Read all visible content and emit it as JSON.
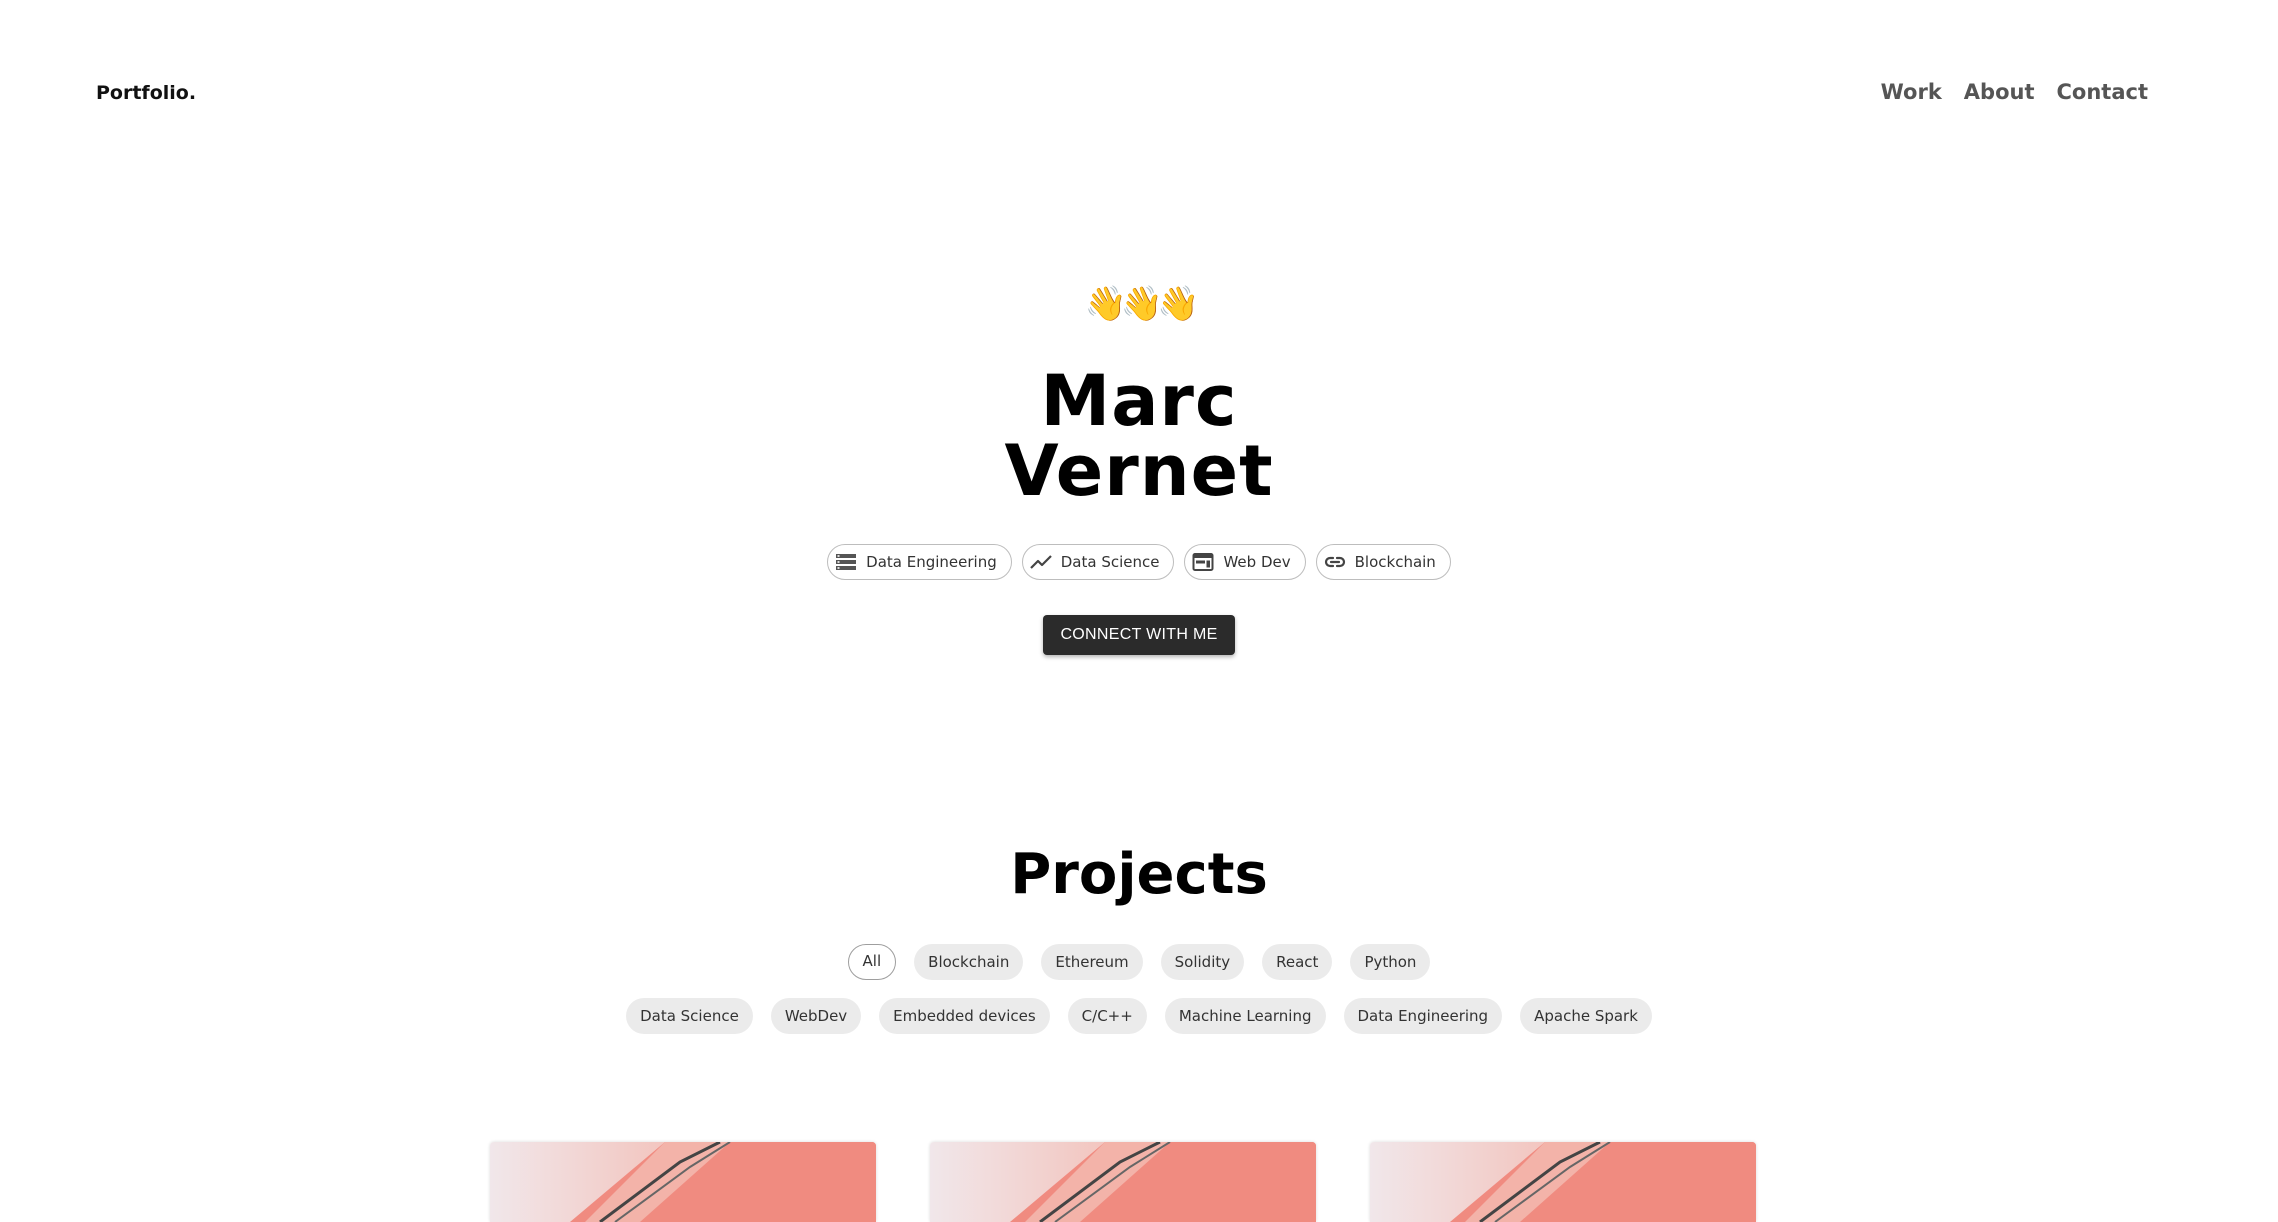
{
  "header": {
    "brand": "Portfolio.",
    "nav": [
      "Work",
      "About",
      "Contact"
    ]
  },
  "hero": {
    "wave": "👋👋👋",
    "first_name": "Marc",
    "last_name": "Vernet",
    "skills": [
      {
        "label": "Data Engineering",
        "icon": "storage-icon"
      },
      {
        "label": "Data Science",
        "icon": "trending-line-icon"
      },
      {
        "label": "Web Dev",
        "icon": "web-window-icon"
      },
      {
        "label": "Blockchain",
        "icon": "link-icon"
      }
    ],
    "cta": "CONNECT WITH ME"
  },
  "projects": {
    "title": "Projects",
    "filters_row1": [
      "All",
      "Blockchain",
      "Ethereum",
      "Solidity",
      "React",
      "Python"
    ],
    "filters_row2": [
      "Data Science",
      "WebDev",
      "Embedded devices",
      "C/C++",
      "Machine Learning",
      "Data Engineering",
      "Apache Spark"
    ],
    "active_filter": "All",
    "card_count": 3
  },
  "colors": {
    "cta_bg": "#2b2b2b",
    "chip_bg": "#ebebeb",
    "card_pink": "#f48a7f"
  }
}
